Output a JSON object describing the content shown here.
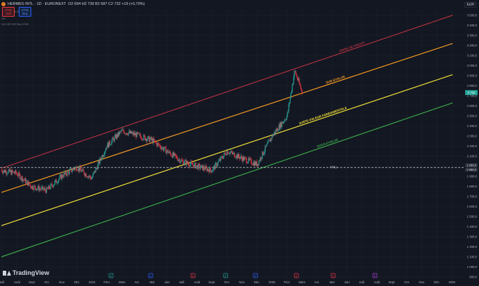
{
  "header": {
    "symbol": "HERMES INTL · 1D · EURONEXT",
    "ohlc": "O2 694 H2 739 B2 687 C2 732 +19 (+0,70%)",
    "sell_price": "2732",
    "sell_label": "Sell",
    "buy_price": "2732",
    "buy_label": "Buy",
    "spread": "0,00",
    "volume": "Vol",
    "volume_line": "Vol  100 000  Buy 2024"
  },
  "currency": "EUR",
  "branding": "TradingView",
  "chart_data": {
    "type": "line",
    "y_axis_ticks": [
      "3 500,0",
      "3 400,0",
      "3 300,0",
      "3 200,0",
      "3 100,0",
      "3 000,0",
      "2 900,0",
      "2 800,0",
      "2 700,0",
      "2 600,0",
      "2 500,0",
      "2 400,0",
      "2 300,0",
      "2 200,0",
      "2 100,0",
      "2 000,0",
      "1 900,0",
      "1 800,0",
      "1 700,0",
      "1 600,0",
      "1 500,0",
      "1 400,0",
      "1 300,0",
      "1 200,0",
      "1 100,0",
      "1 000,0",
      "900,0"
    ],
    "x_axis_ticks": [
      "Juill.",
      "Août",
      "Sept.",
      "Oct.",
      "Nov.",
      "Déc.",
      "2024",
      "Févr.",
      "Mars",
      "Avr.",
      "Mai",
      "Juin",
      "Juill.",
      "Août",
      "Sept.",
      "Oct.",
      "Nov.",
      "Déc.",
      "2025",
      "Févr.",
      "Mars",
      "Avr.",
      "Mai",
      "Juin",
      "Juill.",
      "Août",
      "Sept.",
      "Oct.",
      "Nov.",
      "Déc.",
      "2026"
    ],
    "current_price": "2 732",
    "pru_label": "PRU",
    "pru_value": "1 988,0",
    "pru_value2": "1 988,0",
    "channels": [
      {
        "name": "PRISE DE PROFIT",
        "color": "#b03040",
        "from": [
          2023.5,
          1980
        ],
        "to": [
          2026.0,
          3500
        ]
      },
      {
        "name": "SUR-EVALUE",
        "color": "#f59a23",
        "from": [
          2023.5,
          1740
        ],
        "to": [
          2026.0,
          3220
        ]
      },
      {
        "name": "JUSTE-VALEUR FONDAMENTALE",
        "color": "#f5e23a",
        "from": [
          2023.5,
          1410
        ],
        "to": [
          2026.0,
          2910
        ]
      },
      {
        "name": "SOUS-EVALUE",
        "color": "#3aa84a",
        "from": [
          2023.5,
          1100
        ],
        "to": [
          2026.0,
          2630
        ]
      }
    ],
    "price_series": [
      [
        "2023-07",
        1960
      ],
      [
        "2023-08",
        1930
      ],
      [
        "2023-09",
        1800
      ],
      [
        "2023-10",
        1760
      ],
      [
        "2023-11",
        1900
      ],
      [
        "2023-12",
        1990
      ],
      [
        "2024-01",
        1880
      ],
      [
        "2024-02",
        2200
      ],
      [
        "2024-03",
        2350
      ],
      [
        "2024-04",
        2310
      ],
      [
        "2024-05",
        2260
      ],
      [
        "2024-06",
        2150
      ],
      [
        "2024-07",
        2050
      ],
      [
        "2024-08",
        2000
      ],
      [
        "2024-09",
        1960
      ],
      [
        "2024-10",
        2150
      ],
      [
        "2024-11",
        2080
      ],
      [
        "2024-12",
        2020
      ],
      [
        "2025-01",
        2300
      ],
      [
        "2025-02",
        2500
      ],
      [
        "2025-02-15",
        2950
      ],
      [
        "2025-03",
        2732
      ]
    ],
    "markers": [
      {
        "label": "E",
        "color": "#26a69a"
      },
      {
        "label": "D",
        "color": "#2962ff"
      },
      {
        "label": "E",
        "color": "#f23645"
      },
      {
        "label": "E",
        "color": "#26a69a"
      },
      {
        "label": "D",
        "color": "#2962ff"
      },
      {
        "label": "E",
        "color": "#f23645"
      },
      {
        "label": "E",
        "color": "#f23645"
      },
      {
        "label": "E",
        "color": "#b040e0"
      }
    ],
    "colors": {
      "up": "#26a69a",
      "down": "#f23645",
      "grid": "#1e222d",
      "pru": "#d1d4dc"
    }
  }
}
